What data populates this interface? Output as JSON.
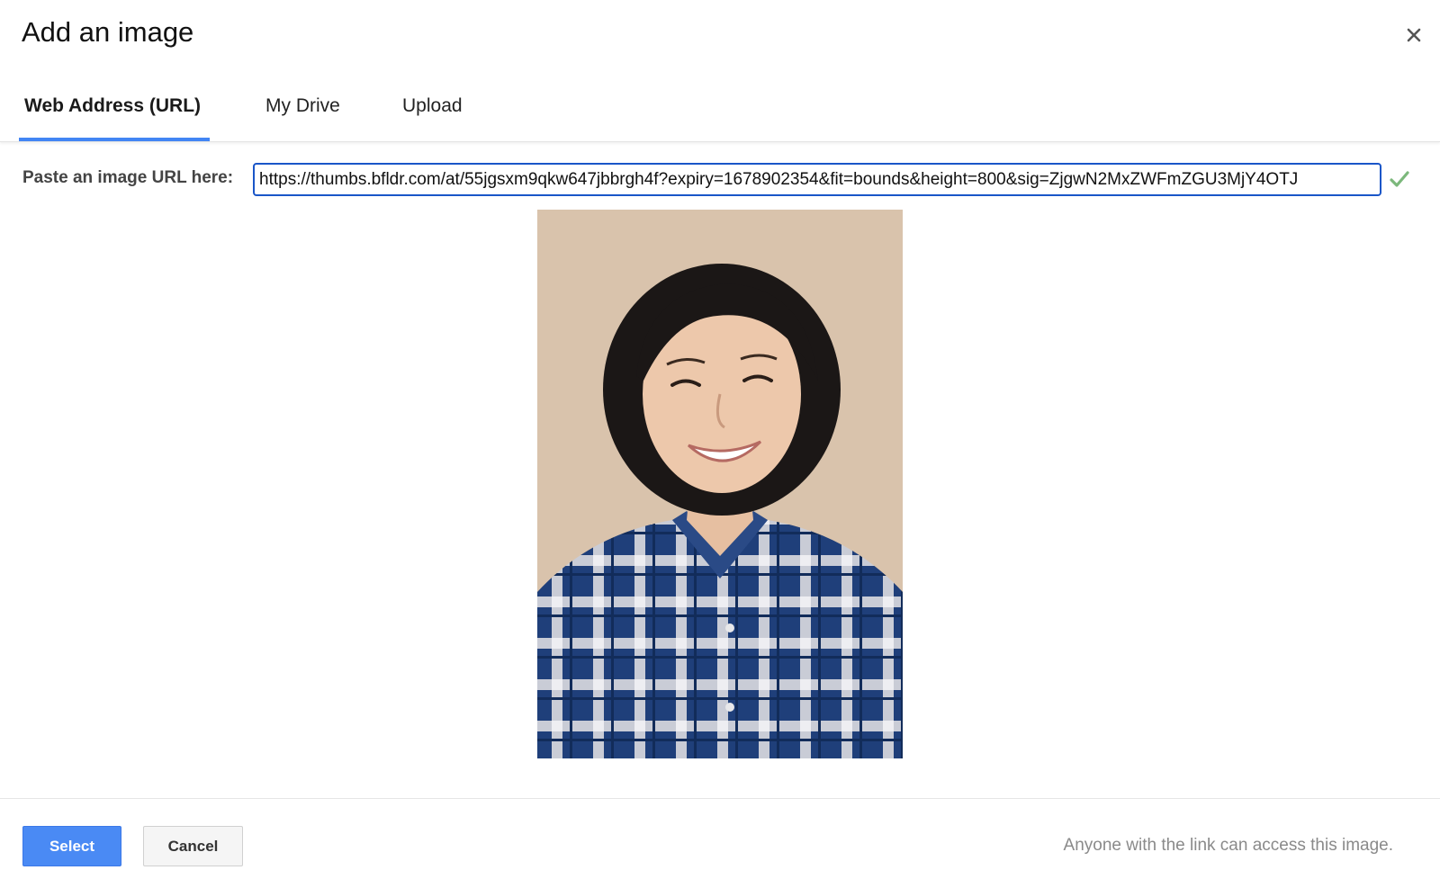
{
  "dialog": {
    "title": "Add an image",
    "close_icon": "close-icon"
  },
  "tabs": [
    {
      "label": "Web Address (URL)",
      "active": true
    },
    {
      "label": "My Drive",
      "active": false
    },
    {
      "label": "Upload",
      "active": false
    }
  ],
  "url_section": {
    "label": "Paste an image URL here:",
    "value": "https://thumbs.bfldr.com/at/55jgsxm9qkw647jbbrgh4f?expiry=1678902354&fit=bounds&height=800&sig=ZjgwN2MxZWFmZGU3MjY4OTJ",
    "status_icon": "check-icon",
    "status_color": "#7cb87c"
  },
  "preview": {
    "kind": "portrait photo preview"
  },
  "footer": {
    "select_label": "Select",
    "cancel_label": "Cancel",
    "note": "Anyone with the link can access this image."
  },
  "colors": {
    "accent": "#4285f4",
    "select_button": "#4a8af4",
    "input_border": "#1a56c8"
  }
}
